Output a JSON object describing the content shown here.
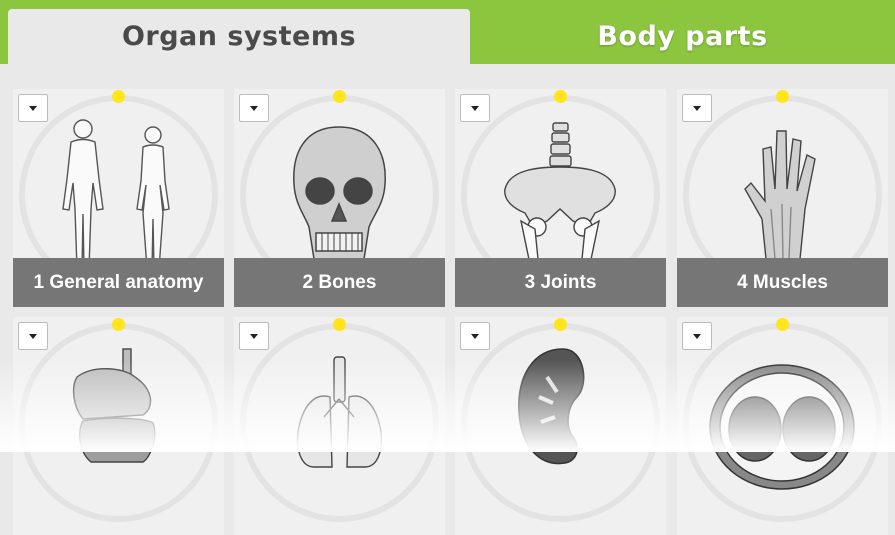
{
  "tabs": [
    {
      "label": "Organ systems",
      "active": true
    },
    {
      "label": "Body parts",
      "active": false
    }
  ],
  "colors": {
    "accent": "#8cc63f",
    "indicator": "#ffe51a",
    "label_bg": "#767676"
  },
  "cards": [
    {
      "label": "1 General anatomy",
      "icon": "human-figures-icon"
    },
    {
      "label": "2 Bones",
      "icon": "skull-icon"
    },
    {
      "label": "3 Joints",
      "icon": "pelvis-icon"
    },
    {
      "label": "4 Muscles",
      "icon": "hand-muscles-icon"
    },
    {
      "label": "",
      "icon": "digestive-system-icon"
    },
    {
      "label": "",
      "icon": "lungs-icon"
    },
    {
      "label": "",
      "icon": "kidney-icon"
    },
    {
      "label": "",
      "icon": "spinal-cord-section-icon"
    }
  ]
}
